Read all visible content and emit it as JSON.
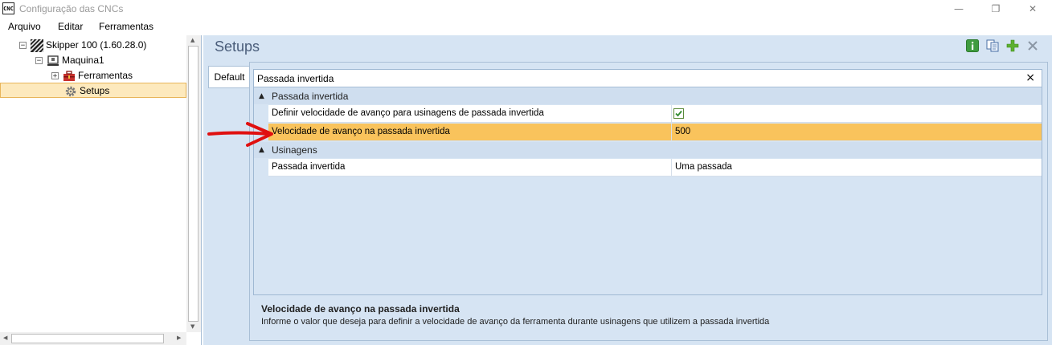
{
  "window": {
    "title": "Configuração das CNCs",
    "icon_label": "CNC",
    "controls": [
      "minimize-icon",
      "maximize-icon",
      "close-icon"
    ]
  },
  "menu": {
    "items": [
      "Arquivo",
      "Editar",
      "Ferramentas"
    ]
  },
  "tree": {
    "nodes": [
      {
        "label": "Skipper 100 (1.60.28.0)",
        "expander": "−",
        "icon": "machine-stripes-icon"
      },
      {
        "label": "Maquina1",
        "expander": "−",
        "icon": "cnc-machine-icon"
      },
      {
        "label": "Ferramentas",
        "expander": "+",
        "icon": "toolbox-icon"
      },
      {
        "label": "Setups",
        "expander": "",
        "icon": "gear-icon"
      }
    ],
    "selected": "Setups"
  },
  "panel": {
    "title": "Setups",
    "toolbar": [
      "info-icon",
      "copy-icon",
      "add-icon",
      "delete-icon"
    ],
    "tabs": [
      {
        "label": "Default"
      }
    ]
  },
  "property_grid": {
    "search_value": "Passada invertida",
    "search_clear": "×",
    "categories": [
      {
        "name": "Passada invertida",
        "properties": [
          {
            "name": "Definir velocidade de avanço para usinagens de passada invertida",
            "value": "",
            "checked": true
          },
          {
            "name": "Velocidade de avanço na passada invertida",
            "value": "500",
            "selected": true
          }
        ]
      },
      {
        "name": "Usinagens",
        "properties": [
          {
            "name": "Passada invertida",
            "value": "Uma passada"
          }
        ]
      }
    ]
  },
  "description": {
    "title": "Velocidade de avanço na passada invertida",
    "text": "Informe o valor que deseja para definir a velocidade de avanço da ferramenta durante usinagens que utilizem a passada invertida"
  },
  "colors": {
    "selected_row": "#f9c35c",
    "panel_bg": "#d6e4f3",
    "annotation_arrow": "#e01010",
    "tree_selection": "#fde9bd"
  }
}
